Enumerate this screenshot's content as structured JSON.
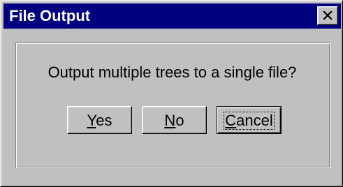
{
  "dialog": {
    "title": "File Output",
    "close_icon": "close-icon",
    "message": "Output multiple trees to a single file?",
    "buttons": {
      "yes": {
        "accel": "Y",
        "rest": "es"
      },
      "no": {
        "accel": "N",
        "rest": "o"
      },
      "cancel": {
        "accel": "C",
        "rest": "ancel"
      }
    },
    "default_button": "cancel"
  },
  "colors": {
    "titlebar": "#000080",
    "face": "#c0c0c0",
    "title_text": "#ffffff"
  }
}
